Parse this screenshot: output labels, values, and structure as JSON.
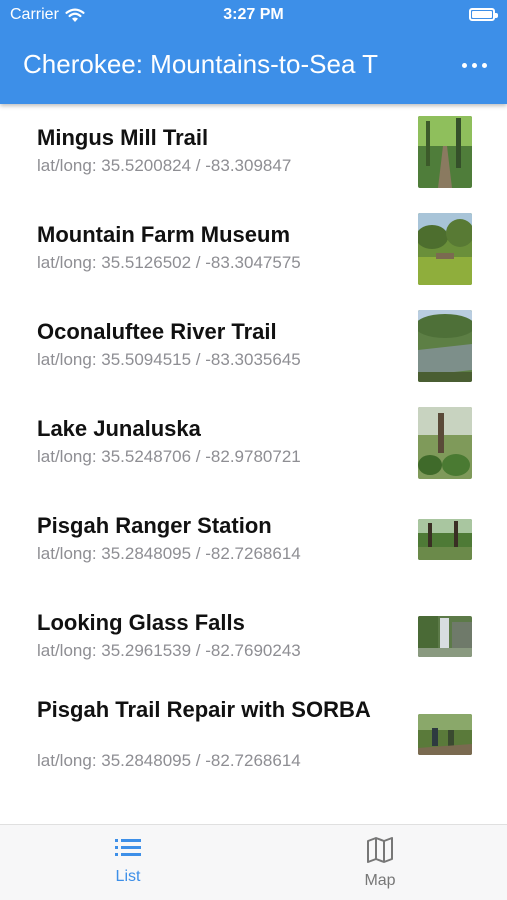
{
  "status_bar": {
    "carrier": "Carrier",
    "time": "3:27 PM"
  },
  "header": {
    "title": "Cherokee: Mountains-to-Sea T",
    "menu_icon": "more-horizontal-icon"
  },
  "places": [
    {
      "name": "Mingus Mill Trail",
      "coords": "lat/long: 35.5200824 / -83.309847"
    },
    {
      "name": "Mountain Farm Museum",
      "coords": "lat/long: 35.5126502 / -83.3047575"
    },
    {
      "name": "Oconaluftee River Trail",
      "coords": "lat/long: 35.5094515 / -83.3035645"
    },
    {
      "name": "Lake Junaluska",
      "coords": "lat/long: 35.5248706 / -82.9780721"
    },
    {
      "name": "Pisgah Ranger Station",
      "coords": "lat/long: 35.2848095 / -82.7268614"
    },
    {
      "name": "Looking Glass Falls",
      "coords": "lat/long: 35.2961539 / -82.7690243"
    },
    {
      "name": "Pisgah Trail Repair with SORBA",
      "coords": "lat/long: 35.2848095 / -82.7268614"
    }
  ],
  "tabs": [
    {
      "label": "List",
      "icon": "list-icon",
      "active": true
    },
    {
      "label": "Map",
      "icon": "map-icon",
      "active": false
    }
  ],
  "colors": {
    "accent": "#3d8fe8",
    "secondary_text": "#8e8e93"
  }
}
